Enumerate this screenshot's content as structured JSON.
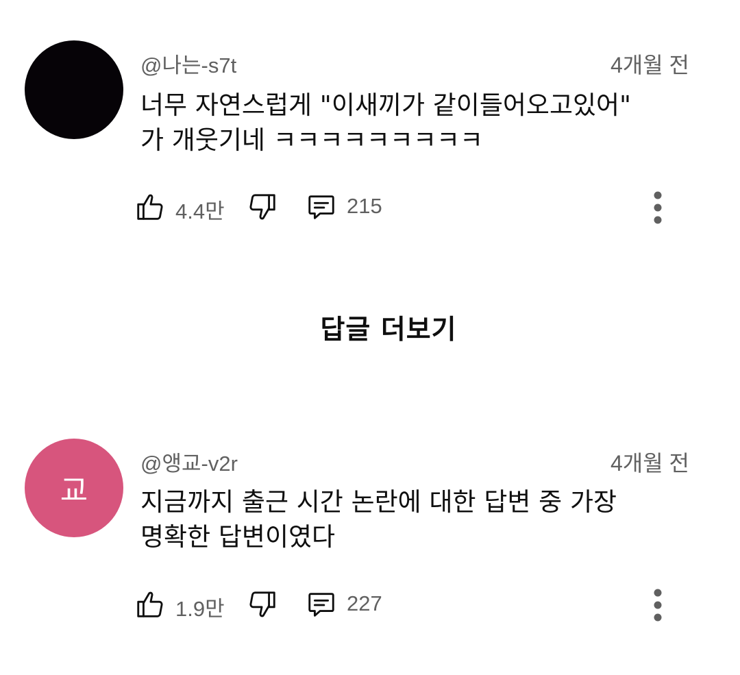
{
  "comments": [
    {
      "handle": "@나는-s7t",
      "time": "4개월 전",
      "text_lines": [
        "너무 자연스럽게 \"이새끼가 같이들어오고있어\"",
        "가 개웃기네 ㅋㅋㅋㅋㅋㅋㅋㅋㅋ"
      ],
      "likes": "4.4만",
      "replies": "215",
      "avatar": {
        "initial": "",
        "color": "#060307"
      }
    },
    {
      "handle": "@앵교-v2r",
      "time": "4개월 전",
      "text_lines": [
        "지금까지 출근 시간 논란에 대한 답변 중 가장",
        "명확한 답변이였다"
      ],
      "likes": "1.9만",
      "replies": "227",
      "avatar": {
        "initial": "교",
        "color": "#d7557d"
      }
    }
  ],
  "view_replies_label": "답글 더보기",
  "icons": {
    "like": "thumbs-up-icon",
    "dislike": "thumbs-down-icon",
    "reply": "comment-icon",
    "more": "more-vert-icon"
  },
  "colors": {
    "text": "#0f0f0f",
    "secondary": "#606060",
    "background": "#ffffff"
  }
}
